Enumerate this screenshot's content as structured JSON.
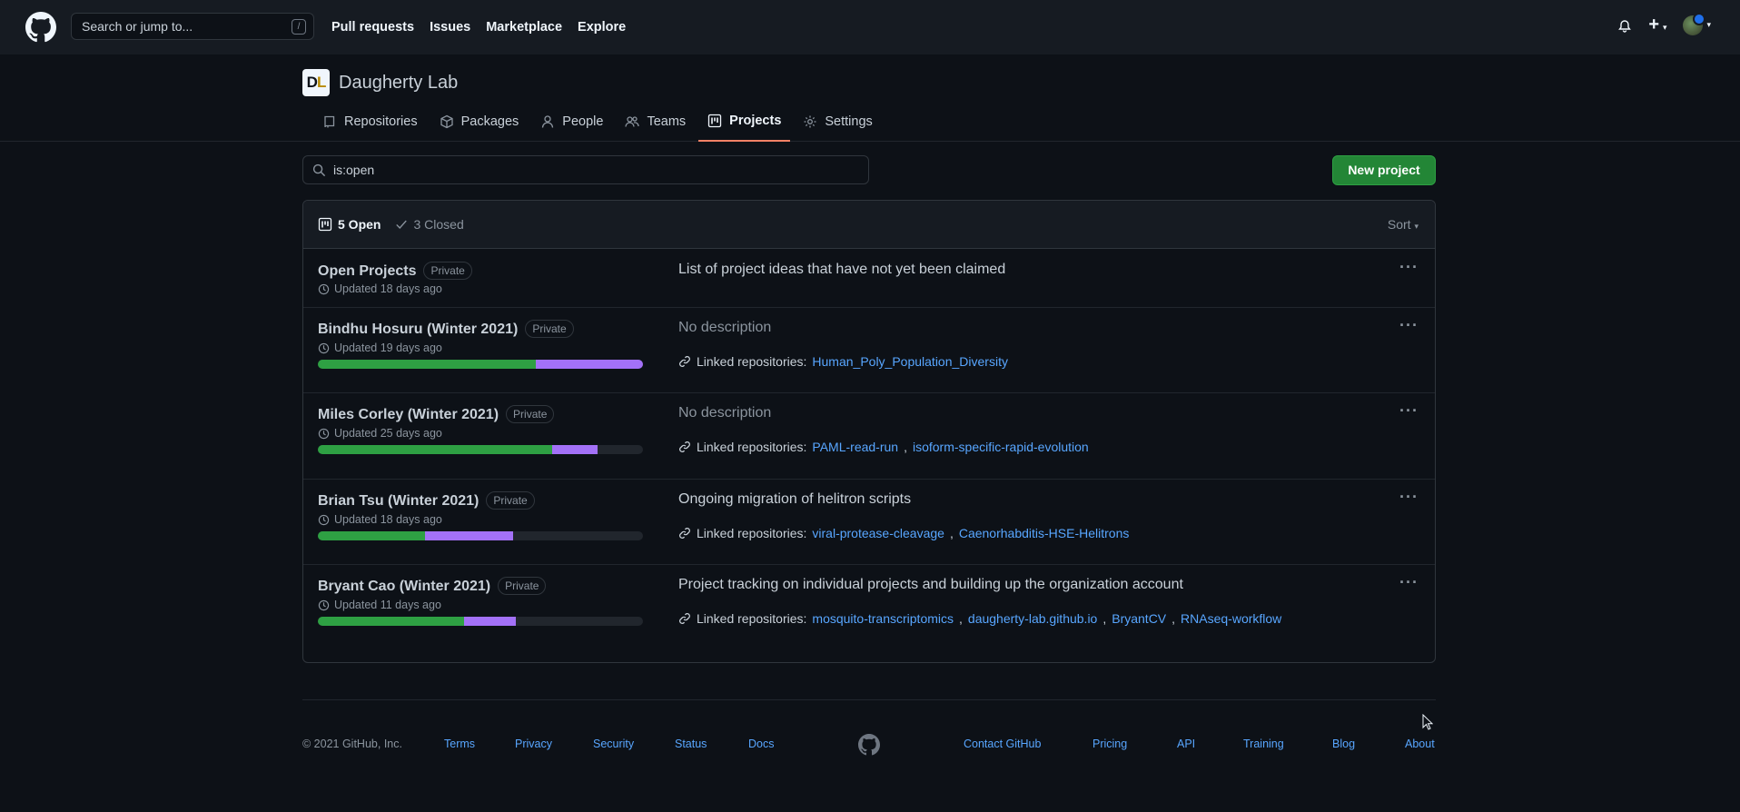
{
  "header": {
    "search_placeholder": "Search or jump to...",
    "search_shortcut": "/",
    "nav": [
      "Pull requests",
      "Issues",
      "Marketplace",
      "Explore"
    ],
    "plus": "+"
  },
  "org": {
    "logo_text_d": "D",
    "logo_text_l": "L",
    "name": "Daugherty Lab"
  },
  "tabs": [
    {
      "label": "Repositories",
      "icon": "repo-icon"
    },
    {
      "label": "Packages",
      "icon": "package-icon"
    },
    {
      "label": "People",
      "icon": "person-icon"
    },
    {
      "label": "Teams",
      "icon": "people-icon"
    },
    {
      "label": "Projects",
      "icon": "project-icon",
      "active": true
    },
    {
      "label": "Settings",
      "icon": "gear-icon"
    }
  ],
  "filter": {
    "value": "is:open"
  },
  "new_project_label": "New project",
  "states": {
    "open": "5 Open",
    "closed": "3 Closed",
    "sort": "Sort"
  },
  "projects": [
    {
      "title": "Open Projects",
      "badge": "Private",
      "updated": "Updated 18 days ago",
      "description": "List of project ideas that have not yet been claimed",
      "linked_label": "",
      "repos": []
    },
    {
      "title": "Bindhu Hosuru (Winter 2021)",
      "badge": "Private",
      "updated": "Updated 19 days ago",
      "progress": {
        "done": 0.67,
        "in_progress": 0.33
      },
      "description": "No description",
      "linked_label": "Linked repositories:",
      "repos": [
        "Human_Poly_Population_Diversity"
      ]
    },
    {
      "title": "Miles Corley (Winter 2021)",
      "badge": "Private",
      "updated": "Updated 25 days ago",
      "progress": {
        "done": 0.72,
        "in_progress": 0.14
      },
      "description": "No description",
      "linked_label": "Linked repositories:",
      "repos": [
        "PAML-read-run",
        "isoform-specific-rapid-evolution"
      ]
    },
    {
      "title": "Brian Tsu (Winter 2021)",
      "badge": "Private",
      "updated": "Updated 18 days ago",
      "progress": {
        "done": 0.33,
        "in_progress": 0.27
      },
      "description": "Ongoing migration of helitron scripts",
      "linked_label": "Linked repositories:",
      "repos": [
        "viral-protease-cleavage",
        "Caenorhabditis-HSE-Helitrons"
      ]
    },
    {
      "title": "Bryant Cao (Winter 2021)",
      "badge": "Private",
      "updated": "Updated 11 days ago",
      "progress": {
        "done": 0.45,
        "in_progress": 0.16
      },
      "description": "Project tracking on individual projects and building up the organization account",
      "linked_label": "Linked repositories:",
      "repos": [
        "mosquito-transcriptomics",
        "daugherty-lab.github.io",
        "BryantCV",
        "RNAseq-workflow"
      ]
    }
  ],
  "footer": {
    "copyright": "© 2021 GitHub, Inc.",
    "left_links": [
      "Terms",
      "Privacy",
      "Security",
      "Status",
      "Docs"
    ],
    "right_links": [
      "Contact GitHub",
      "Pricing",
      "API",
      "Training",
      "Blog",
      "About"
    ]
  },
  "colors": {
    "background": "#0d1117",
    "header": "#161b22",
    "link": "#58a6ff",
    "primary_button": "#238636",
    "progress_done": "#2ea043",
    "progress_in_progress": "#a371f7",
    "active_tab_underline": "#f78166"
  }
}
